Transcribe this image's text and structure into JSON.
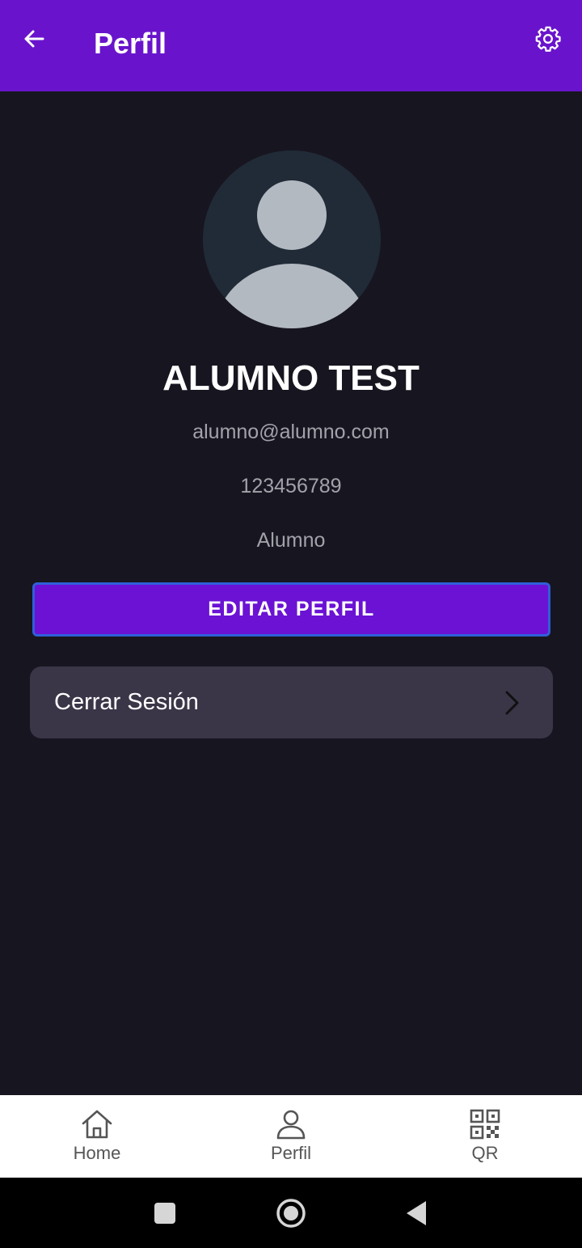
{
  "app_bar": {
    "title": "Perfil",
    "back_icon": "arrow-left-icon",
    "settings_icon": "gear-icon",
    "color": "#6914cc"
  },
  "profile": {
    "avatar_icon": "person-avatar-icon",
    "name": "ALUMNO TEST",
    "email": "alumno@alumno.com",
    "phone": "123456789",
    "role": "Alumno"
  },
  "actions": {
    "edit_label": "EDITAR PERFIL",
    "logout_label": "Cerrar Sesión"
  },
  "bottom_nav": {
    "items": [
      {
        "label": "Home",
        "icon": "home-icon"
      },
      {
        "label": "Perfil",
        "icon": "user-icon"
      },
      {
        "label": "QR",
        "icon": "qr-code-icon"
      }
    ]
  },
  "system_nav": {
    "icons": [
      "recents-square-icon",
      "home-circle-icon",
      "back-triangle-icon"
    ]
  },
  "colors": {
    "background": "#17151f",
    "primary": "#6914cc",
    "card": "#3b3548",
    "muted_text": "#a3a2aa"
  }
}
